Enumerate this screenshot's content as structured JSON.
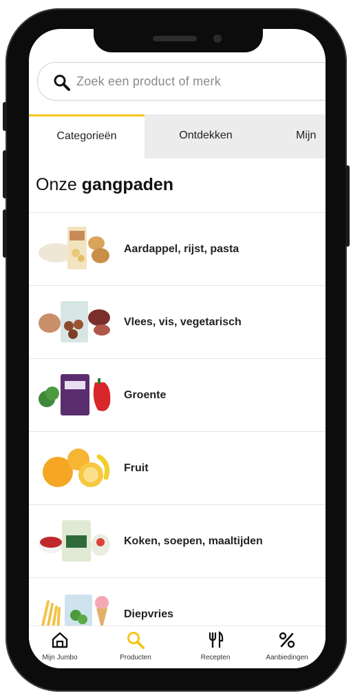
{
  "search": {
    "placeholder": "Zoek een product of merk"
  },
  "tabs": [
    {
      "label": "Categorieën"
    },
    {
      "label": "Ontdekken"
    },
    {
      "label": "Mijn"
    }
  ],
  "heading": {
    "prefix": "Onze",
    "bold": "gangpaden"
  },
  "categories": [
    {
      "label": "Aardappel, rijst, pasta"
    },
    {
      "label": "Vlees, vis, vegetarisch"
    },
    {
      "label": "Groente"
    },
    {
      "label": "Fruit"
    },
    {
      "label": "Koken, soepen, maaltijden"
    },
    {
      "label": "Diepvries"
    }
  ],
  "bottom_nav": [
    {
      "label": "Mijn Jumbo",
      "icon": "home-icon"
    },
    {
      "label": "Producten",
      "icon": "search-icon"
    },
    {
      "label": "Recepten",
      "icon": "fork-knife-icon"
    },
    {
      "label": "Aanbiedingen",
      "icon": "percent-icon"
    }
  ],
  "colors": {
    "accent": "#f5c518",
    "tab_inactive_bg": "#ececec",
    "text": "#222222"
  }
}
